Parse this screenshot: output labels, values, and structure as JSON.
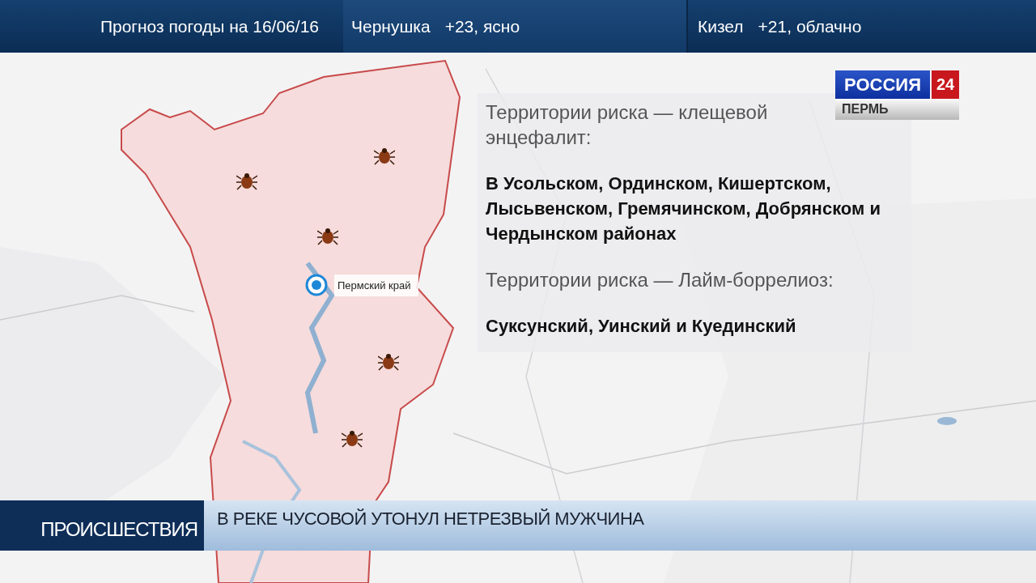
{
  "header": {
    "title": "Прогноз погоды на 16/06/16",
    "forecasts": [
      {
        "city": "Чернушка",
        "weather": "+23, ясно"
      },
      {
        "city": "Кизел",
        "weather": "+21, облачно"
      }
    ]
  },
  "logo": {
    "name": "РОССИЯ",
    "number": "24",
    "region": "ПЕРМЬ"
  },
  "map": {
    "kind": "picture",
    "marker": {
      "label": "Пермский край"
    }
  },
  "info_panel": {
    "sections": [
      {
        "heading": "Территории риска — клещевой энцефалит:",
        "districts": "В Усольском, Ординском, Кишертском, Лысьвенском, Гремячинском, Добрянском и Чердынском районах"
      },
      {
        "heading": "Территории риска —  Лайм-боррелиоз:",
        "districts": "Суксунский, Уинский и Куединский"
      }
    ]
  },
  "ticker": {
    "category": "ПРОИСШЕСТВИЯ",
    "headline": "В РЕКЕ ЧУСОВОЙ УТОНУЛ НЕТРЕЗВЫЙ МУЖЧИНА"
  }
}
